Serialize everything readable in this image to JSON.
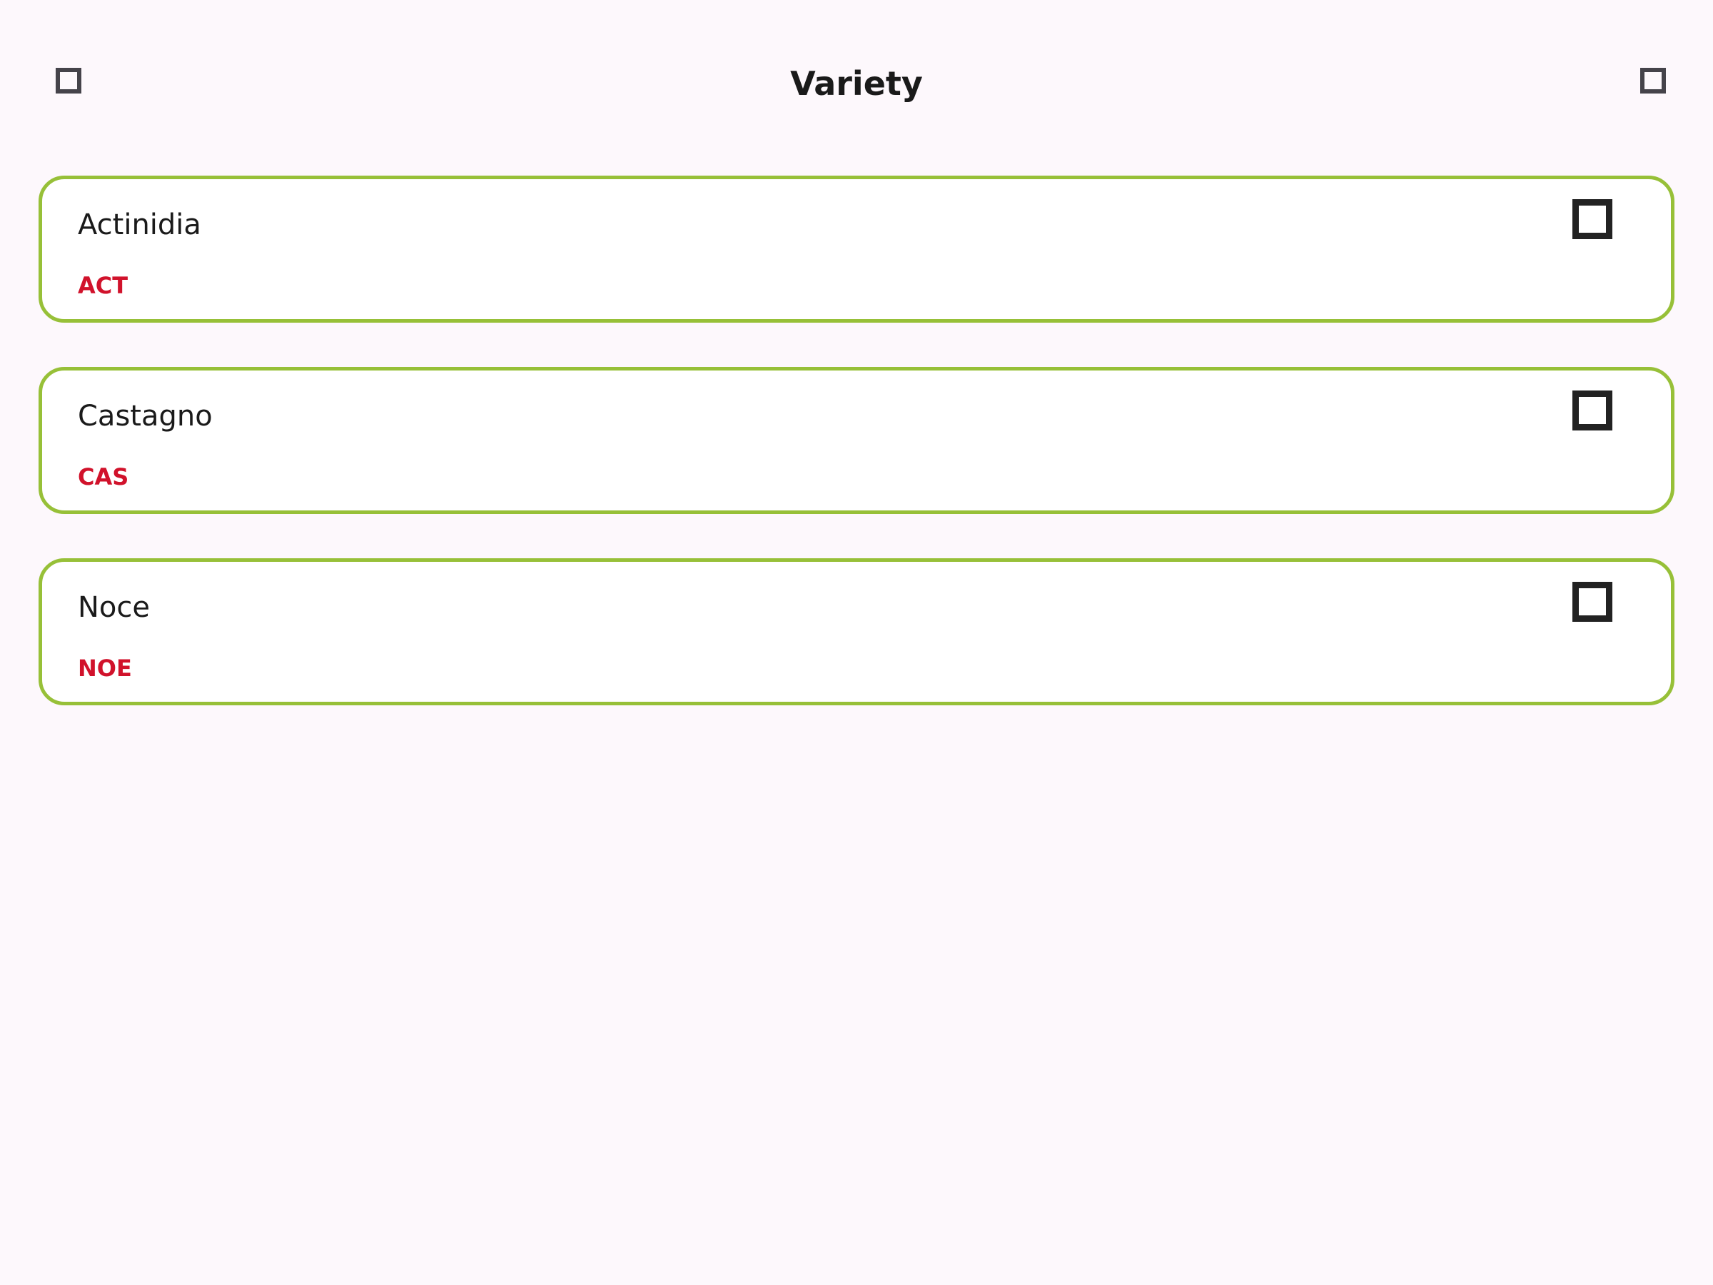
{
  "app_bar": {
    "title": "Variety",
    "left_icon": "square-icon",
    "right_icon": "square-icon"
  },
  "varieties": [
    {
      "name": "Actinidia",
      "code": "ACT",
      "checked": false
    },
    {
      "name": "Castagno",
      "code": "CAS",
      "checked": false
    },
    {
      "name": "Noce",
      "code": "NOE",
      "checked": false
    }
  ],
  "colors": {
    "background": "#fdf8fc",
    "card_border": "#97c038",
    "code_text": "#d1122b",
    "checkbox": "#222222",
    "nav_icon": "#45434a"
  }
}
